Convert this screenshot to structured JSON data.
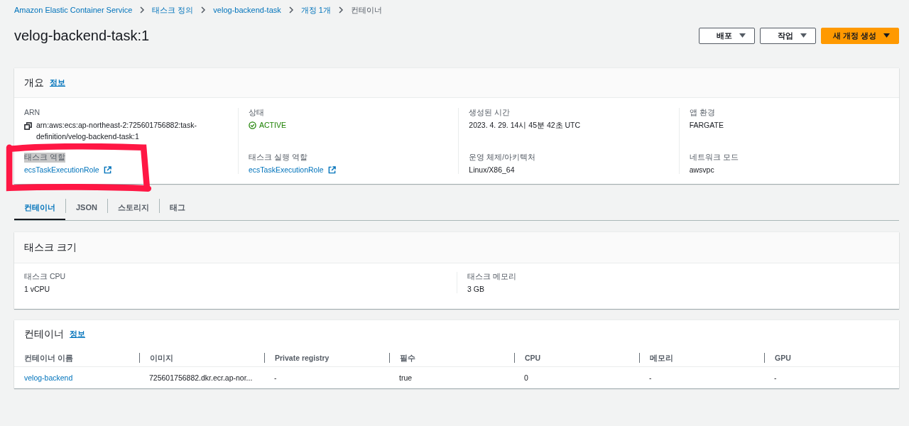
{
  "breadcrumb": [
    {
      "label": "Amazon Elastic Container Service",
      "link": true
    },
    {
      "label": "태스크 정의",
      "link": true
    },
    {
      "label": "velog-backend-task",
      "link": true
    },
    {
      "label": "개정 1개",
      "link": true
    },
    {
      "label": "컨테이너",
      "link": false
    }
  ],
  "title": "velog-backend-task:1",
  "actions": [
    {
      "label": "배포",
      "kind": "secondary"
    },
    {
      "label": "작업",
      "kind": "secondary"
    },
    {
      "label": "새 개정 생성",
      "kind": "primary"
    }
  ],
  "overview": {
    "title": "개요",
    "info": "정보",
    "columns": [
      {
        "fields": [
          {
            "label": "ARN",
            "value": "arn:aws:ecs:ap-northeast-2:725601756882:task-definition/velog-backend-task:1",
            "kind": "copy",
            "highlighted": false
          },
          {
            "label": "태스크 역할",
            "value": "ecsTaskExecutionRole",
            "kind": "external-link",
            "highlighted": true
          }
        ]
      },
      {
        "fields": [
          {
            "label": "상태",
            "value": "ACTIVE",
            "kind": "status",
            "highlighted": false
          },
          {
            "label": "태스크 실행 역할",
            "value": "ecsTaskExecutionRole",
            "kind": "external-link",
            "highlighted": false
          }
        ]
      },
      {
        "fields": [
          {
            "label": "생성된 시간",
            "value": "2023. 4. 29. 14시 45분 42초 UTC",
            "kind": "text",
            "highlighted": false
          },
          {
            "label": "운영 체제/아키텍처",
            "value": "Linux/X86_64",
            "kind": "text",
            "highlighted": false
          }
        ]
      },
      {
        "fields": [
          {
            "label": "앱 환경",
            "value": "FARGATE",
            "kind": "text",
            "highlighted": false
          },
          {
            "label": "네트워크 모드",
            "value": "awsvpc",
            "kind": "text",
            "highlighted": false
          }
        ]
      }
    ]
  },
  "tabs": [
    {
      "label": "컨테이너",
      "selected": true
    },
    {
      "label": "JSON",
      "selected": false
    },
    {
      "label": "스토리지",
      "selected": false
    },
    {
      "label": "태그",
      "selected": false
    }
  ],
  "task_size": {
    "title": "태스크 크기",
    "fields": [
      {
        "label": "태스크 CPU",
        "value": "1 vCPU"
      },
      {
        "label": "태스크 메모리",
        "value": "3 GB"
      }
    ]
  },
  "containers": {
    "title": "컨테이너",
    "info": "정보",
    "columns": [
      "컨테이너 이름",
      "이미지",
      "Private registry",
      "필수",
      "CPU",
      "메모리",
      "GPU"
    ],
    "rows": [
      {
        "cells": [
          "velog-backend",
          "725601756882.dkr.ecr.ap-nor...",
          "-",
          "true",
          "0",
          "-",
          "-"
        ]
      }
    ]
  }
}
